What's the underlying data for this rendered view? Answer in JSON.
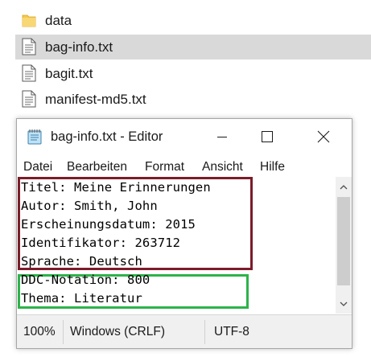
{
  "explorer": {
    "files": [
      {
        "name": "data",
        "icon": "folder-icon",
        "selected": false
      },
      {
        "name": "bag-info.txt",
        "icon": "text-file-icon",
        "selected": true
      },
      {
        "name": "bagit.txt",
        "icon": "text-file-icon",
        "selected": false
      },
      {
        "name": "manifest-md5.txt",
        "icon": "text-file-icon",
        "selected": false
      }
    ]
  },
  "notepad": {
    "title": "bag-info.txt - Editor",
    "menu": [
      "Datei",
      "Bearbeiten",
      "Format",
      "Ansicht",
      "Hilfe"
    ],
    "lines": [
      "Titel: Meine Erinnerungen",
      "Autor: Smith, John",
      "Erscheinungsdatum: 2015",
      "Identifikator: 263712",
      "Sprache: Deutsch",
      "DDC-Notation: 800",
      "Thema: Literatur"
    ],
    "status": {
      "zoom": "100%",
      "line_endings": "Windows (CRLF)",
      "encoding": "UTF-8"
    }
  },
  "colors": {
    "highlight_box_1": "#7b1c2a",
    "highlight_box_2": "#2db34a",
    "selection": "#d9d9d9"
  }
}
